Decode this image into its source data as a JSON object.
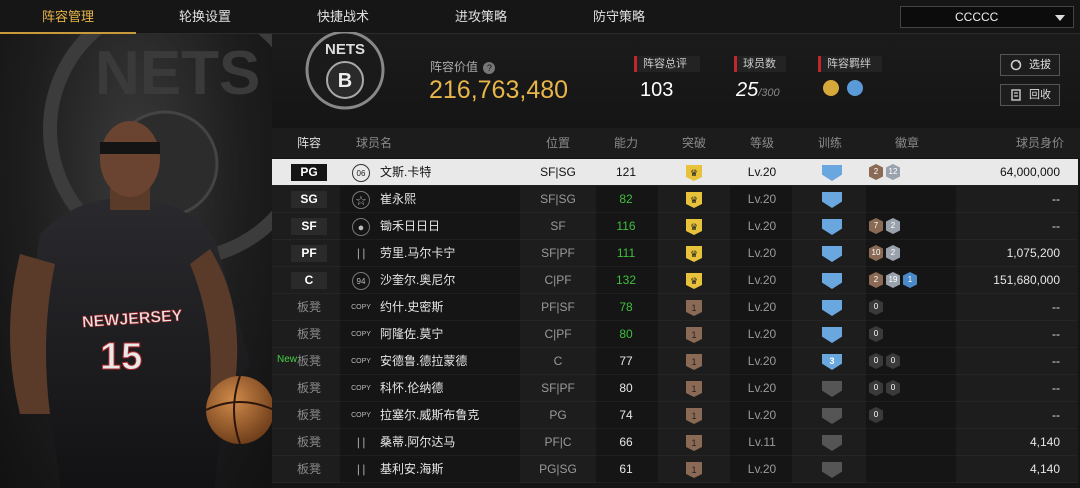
{
  "tabs": [
    {
      "label": "阵容管理",
      "active": true
    },
    {
      "label": "轮换设置",
      "active": false
    },
    {
      "label": "快捷战术",
      "active": false
    },
    {
      "label": "进攻策略",
      "active": false
    },
    {
      "label": "防守策略",
      "active": false
    }
  ],
  "team_select": {
    "value": "CCCCC"
  },
  "logo": {
    "text": "NETS",
    "letter": "B"
  },
  "header": {
    "value_label": "阵容价值",
    "value": "216,763,480",
    "rating_label": "阵容总评",
    "rating": "103",
    "players_label": "球员数",
    "players": "25",
    "players_max": "/300",
    "bonds_label": "阵容羁绊",
    "btn_select": "选拔",
    "btn_recycle": "回收"
  },
  "columns": {
    "lineup": "阵容",
    "name": "球员名",
    "position": "位置",
    "ability": "能力",
    "breakthrough": "突破",
    "level": "等级",
    "training": "训练",
    "badges": "徽章",
    "value": "球员身价"
  },
  "bench_label": "板凳",
  "new_label": "New",
  "rows": [
    {
      "slot": "PG",
      "icon": "06",
      "name": "文斯.卡特",
      "pos": "SF|SG",
      "ability": "121",
      "ability_color": "white",
      "break": "gold",
      "level": "Lv.20",
      "train": "blue",
      "train_num": "",
      "badges": [
        "2",
        "12"
      ],
      "badge_colors": [
        "#8a6a55",
        "#9aa3ad"
      ],
      "value": "64,000,000",
      "new": false,
      "selected": true
    },
    {
      "slot": "SG",
      "icon": "star",
      "name": "崔永熙",
      "pos": "SF|SG",
      "ability": "82",
      "ability_color": "green",
      "break": "gold",
      "level": "Lv.20",
      "train": "blue",
      "train_num": "",
      "badges": [],
      "badge_colors": [],
      "value": "--",
      "new": false,
      "selected": false
    },
    {
      "slot": "SF",
      "icon": "person",
      "name": "锄禾日日日",
      "pos": "SF",
      "ability": "116",
      "ability_color": "green",
      "break": "gold",
      "level": "Lv.20",
      "train": "blue",
      "train_num": "",
      "badges": [
        "7",
        "2"
      ],
      "badge_colors": [
        "#8a6a55",
        "#9aa3ad"
      ],
      "value": "--",
      "new": false,
      "selected": false
    },
    {
      "slot": "PF",
      "icon": "bars",
      "name": "劳里.马尔卡宁",
      "pos": "SF|PF",
      "ability": "111",
      "ability_color": "green",
      "break": "gold",
      "level": "Lv.20",
      "train": "blue",
      "train_num": "",
      "badges": [
        "10",
        "2"
      ],
      "badge_colors": [
        "#8a6a55",
        "#9aa3ad"
      ],
      "value": "1,075,200",
      "new": false,
      "selected": false
    },
    {
      "slot": "C",
      "icon": "94",
      "name": "沙奎尔.奥尼尔",
      "pos": "C|PF",
      "ability": "132",
      "ability_color": "green",
      "break": "gold",
      "level": "Lv.20",
      "train": "blue",
      "train_num": "",
      "badges": [
        "2",
        "19",
        "1"
      ],
      "badge_colors": [
        "#8a6a55",
        "#9aa3ad",
        "#4a88c8"
      ],
      "value": "151,680,000",
      "new": false,
      "selected": false
    },
    {
      "slot": "",
      "icon": "COPY",
      "name": "约什.史密斯",
      "pos": "PF|SF",
      "ability": "78",
      "ability_color": "green",
      "break": "bronze",
      "level": "Lv.20",
      "train": "blue",
      "train_num": "",
      "badges": [
        "0"
      ],
      "badge_colors": [
        "#3a3a3a"
      ],
      "value": "--",
      "new": false,
      "selected": false
    },
    {
      "slot": "",
      "icon": "COPY",
      "name": "阿隆佐.莫宁",
      "pos": "C|PF",
      "ability": "80",
      "ability_color": "green",
      "break": "bronze",
      "level": "Lv.20",
      "train": "blue",
      "train_num": "",
      "badges": [
        "0"
      ],
      "badge_colors": [
        "#3a3a3a"
      ],
      "value": "--",
      "new": false,
      "selected": false
    },
    {
      "slot": "",
      "icon": "COPY",
      "name": "安德鲁.德拉蒙德",
      "pos": "C",
      "ability": "77",
      "ability_color": "white",
      "break": "bronze",
      "level": "Lv.20",
      "train": "blue",
      "train_num": "3",
      "badges": [
        "0",
        "0"
      ],
      "badge_colors": [
        "#3a3a3a",
        "#3a3a3a"
      ],
      "value": "--",
      "new": true,
      "selected": false
    },
    {
      "slot": "",
      "icon": "COPY",
      "name": "科怀.伦纳德",
      "pos": "SF|PF",
      "ability": "80",
      "ability_color": "white",
      "break": "bronze",
      "level": "Lv.20",
      "train": "grey",
      "train_num": "",
      "badges": [
        "0",
        "0"
      ],
      "badge_colors": [
        "#3a3a3a",
        "#3a3a3a"
      ],
      "value": "--",
      "new": false,
      "selected": false
    },
    {
      "slot": "",
      "icon": "COPY",
      "name": "拉塞尔.威斯布鲁克",
      "pos": "PG",
      "ability": "74",
      "ability_color": "white",
      "break": "bronze",
      "level": "Lv.20",
      "train": "grey",
      "train_num": "",
      "badges": [
        "0"
      ],
      "badge_colors": [
        "#3a3a3a"
      ],
      "value": "--",
      "new": false,
      "selected": false
    },
    {
      "slot": "",
      "icon": "bars",
      "name": "桑蒂.阿尔达马",
      "pos": "PF|C",
      "ability": "66",
      "ability_color": "white",
      "break": "bronze",
      "level": "Lv.11",
      "train": "grey",
      "train_num": "",
      "badges": [],
      "badge_colors": [],
      "value": "4,140",
      "new": false,
      "selected": false
    },
    {
      "slot": "",
      "icon": "bars",
      "name": "基利安.海斯",
      "pos": "PG|SG",
      "ability": "61",
      "ability_color": "white",
      "break": "bronze",
      "level": "Lv.20",
      "train": "grey",
      "train_num": "",
      "badges": [],
      "badge_colors": [],
      "value": "4,140",
      "new": false,
      "selected": false
    }
  ],
  "player_art": {
    "jersey_team": "NEWJERSEY",
    "jersey_number": "15"
  },
  "colors": {
    "gold": "#e8b54a",
    "accent_red": "#c0262c",
    "green": "#3fbf3f"
  }
}
